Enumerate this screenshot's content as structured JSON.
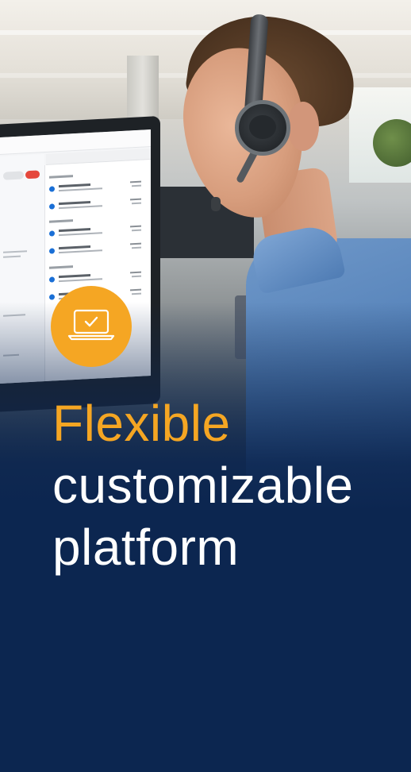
{
  "headline": {
    "accent_line": "Flexible",
    "line_2": "customizable",
    "line_3": "platform"
  },
  "badge": {
    "icon": "laptop-check-icon",
    "color": "#f5a623"
  },
  "colors": {
    "background": "#0c2650",
    "accent": "#f5a623",
    "text": "#ffffff"
  }
}
